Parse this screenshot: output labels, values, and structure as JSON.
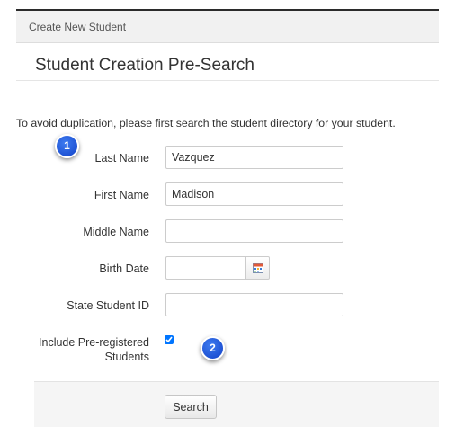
{
  "panel": {
    "header": "Create New Student"
  },
  "section": {
    "title": "Student Creation Pre-Search"
  },
  "intro": "To avoid duplication, please first search the student directory for your student.",
  "form": {
    "last_name": {
      "label": "Last Name",
      "value": "Vazquez"
    },
    "first_name": {
      "label": "First Name",
      "value": "Madison"
    },
    "middle_name": {
      "label": "Middle Name",
      "value": ""
    },
    "birth_date": {
      "label": "Birth Date",
      "value": "",
      "icon": "calendar-icon"
    },
    "state_student_id": {
      "label": "State Student ID",
      "value": ""
    },
    "include_preregistered": {
      "label_line1": "Include Pre-registered",
      "label_line2": "Students",
      "checked": true
    }
  },
  "callouts": {
    "first": "1",
    "second": "2"
  },
  "actions": {
    "search_label": "Search"
  },
  "colors": {
    "callout_blue": "#1e52d8",
    "header_bg": "#f1f1f1",
    "footer_bg": "#f5f5f5"
  }
}
